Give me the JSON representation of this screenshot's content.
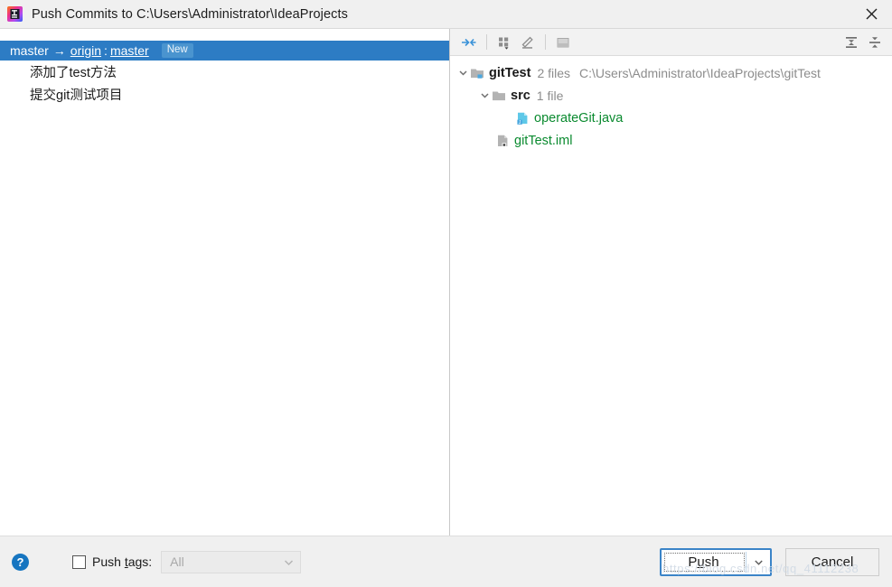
{
  "window": {
    "title": "Push Commits to C:\\Users\\Administrator\\IdeaProjects",
    "app_icon": "intellij-idea-icon",
    "close_label": "×"
  },
  "commits_panel": {
    "repo_row": {
      "local_branch": "master",
      "arrow": "→",
      "remote": "origin",
      "colon": ":",
      "remote_branch": "master",
      "badge": "New",
      "selected_color": "#2d7cc4"
    },
    "commits": [
      {
        "message": "添加了test方法"
      },
      {
        "message": "提交git测试项目"
      }
    ]
  },
  "changes_panel": {
    "toolbar": [
      {
        "name": "show-diff-icon",
        "title": "Show Diff"
      },
      {
        "name": "group-by-icon",
        "title": "Group By"
      },
      {
        "name": "edit-source-icon",
        "title": "Edit Source"
      },
      {
        "name": "preview-diff-icon",
        "title": "Preview Diff"
      },
      {
        "name": "expand-all-icon",
        "title": "Expand All"
      },
      {
        "name": "collapse-all-icon",
        "title": "Collapse All"
      }
    ],
    "tree": [
      {
        "label": "gitTest",
        "icon": "module-folder-icon",
        "meta": "2 files",
        "path": "C:\\Users\\Administrator\\IdeaProjects\\gitTest",
        "indent": 0,
        "expanded": true,
        "bold": true,
        "color": "#1a1a1a"
      },
      {
        "label": "src",
        "icon": "folder-icon",
        "meta": "1 file",
        "path": "",
        "indent": 1,
        "expanded": true,
        "bold": true,
        "color": "#1a1a1a"
      },
      {
        "label": "operateGit.java",
        "icon": "java-file-icon",
        "meta": "",
        "path": "",
        "indent": 2,
        "expanded": null,
        "bold": false,
        "color": "#0a8a2f"
      },
      {
        "label": "gitTest.iml",
        "icon": "iml-file-icon",
        "meta": "",
        "path": "",
        "indent": 1,
        "expanded": null,
        "bold": false,
        "color": "#0a8a2f"
      }
    ]
  },
  "bottom_bar": {
    "help_label": "?",
    "push_tags": {
      "checked": false,
      "label_pre": "Push ",
      "label_mnemonic": "t",
      "label_post": "ags:",
      "combo_value": "All",
      "combo_enabled": false
    },
    "push_button": {
      "label_pre": "P",
      "label_mnemonic": "u",
      "label_post": "sh",
      "has_dropdown": true,
      "focused": true,
      "accent_color": "#3b84c8"
    },
    "cancel_button": {
      "label": "Cancel"
    }
  },
  "watermark": {
    "text": "https://blog.csdn.net/qq_41112238"
  }
}
